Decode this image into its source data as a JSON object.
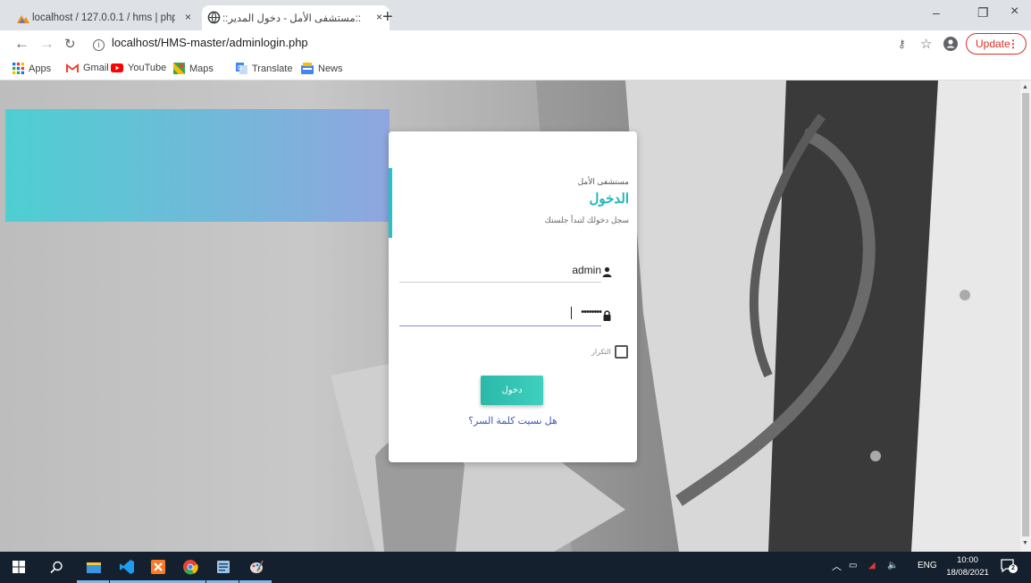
{
  "browser": {
    "tabs": [
      {
        "label": "localhost / 127.0.0.1 / hms | php",
        "close": "×"
      },
      {
        "label": "::مستشفى الأمل - دخول المدير::",
        "close": "×"
      }
    ],
    "new_tab": "+",
    "window_controls": {
      "minimize": "–",
      "restore": "❐",
      "close": "×"
    },
    "url": "localhost/HMS-master/adminlogin.php",
    "update_label": "Update",
    "update_dots": "⋮",
    "bookmarks": [
      "Apps",
      "Gmail",
      "YouTube",
      "Maps",
      "Translate",
      "News"
    ]
  },
  "login": {
    "hospital_name": "مستشفى الأمل",
    "title": "الدخول",
    "subtitle": "سجل دخولك لتبدأ جلستك",
    "username_value": "admin",
    "password_value": "••••••••",
    "remember_label": "التكرار",
    "remember_checked": false,
    "submit_label": "دخول",
    "forgot_link": "هل نسيت كلمة السر؟"
  },
  "taskbar": {
    "lang": "ENG",
    "time": "10:00",
    "date": "18/08/2021",
    "notifications": "2"
  },
  "colors": {
    "accent": "#25c2c7",
    "band_start": "#4ecfd2",
    "band_end": "#8fa6df",
    "update": "#d93025",
    "link": "#3d5bb8"
  }
}
